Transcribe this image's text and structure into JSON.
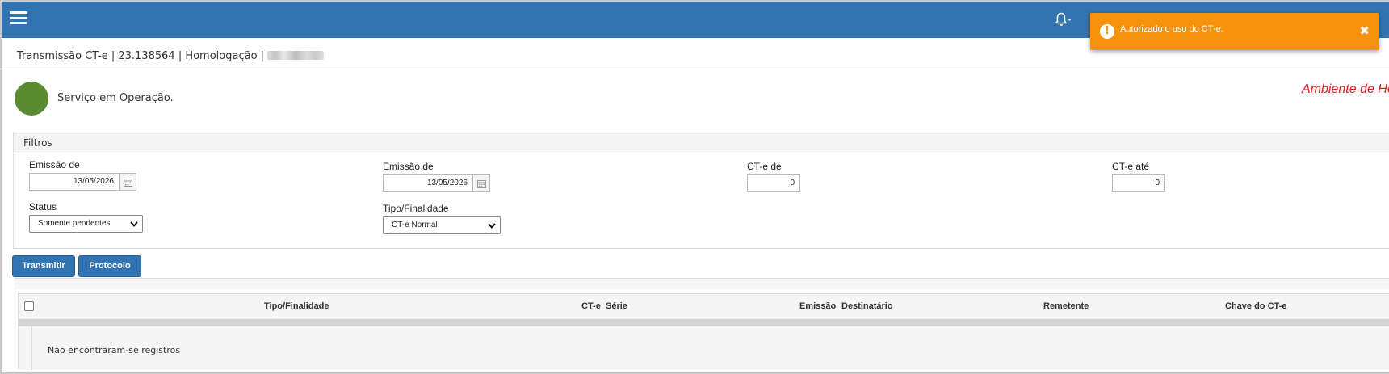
{
  "header": {
    "menu_icon": "hamburger-icon",
    "bell_icon": "bell-icon",
    "bg_color": "#3174b1"
  },
  "toast": {
    "message": "Autorizado o uso do CT-e.",
    "icon": "exclamation-circle-icon",
    "close_icon": "close-icon",
    "bg_color": "#f7920d"
  },
  "breadcrumb": {
    "text": "Transmissão CT-e | 23.138564 | Homologação | "
  },
  "service_status": {
    "text": "Serviço em Operação.",
    "indicator_color": "#5a8a32"
  },
  "environment_banner": {
    "text": "Ambiente de Ho"
  },
  "filters": {
    "title": "Filtros",
    "emissao_de_1": {
      "label": "Emissão de",
      "value": "13/05/2026"
    },
    "emissao_de_2": {
      "label": "Emissão de",
      "value": "13/05/2026"
    },
    "cte_de": {
      "label": "CT-e de",
      "value": "0"
    },
    "cte_ate": {
      "label": "CT-e até",
      "value": "0"
    },
    "status": {
      "label": "Status",
      "selected": "Somente pendentes"
    },
    "tipo_finalidade": {
      "label": "Tipo/Finalidade",
      "selected": "CT-e Normal"
    }
  },
  "actions": {
    "transmitir": "Transmitir",
    "protocolo": "Protocolo"
  },
  "table": {
    "columns": [
      "Tipo/Finalidade",
      "CT-e",
      "Série",
      "Emissão",
      "Destinatário",
      "Remetente",
      "Chave do CT-e"
    ],
    "empty_message": "Não encontraram-se registros"
  }
}
